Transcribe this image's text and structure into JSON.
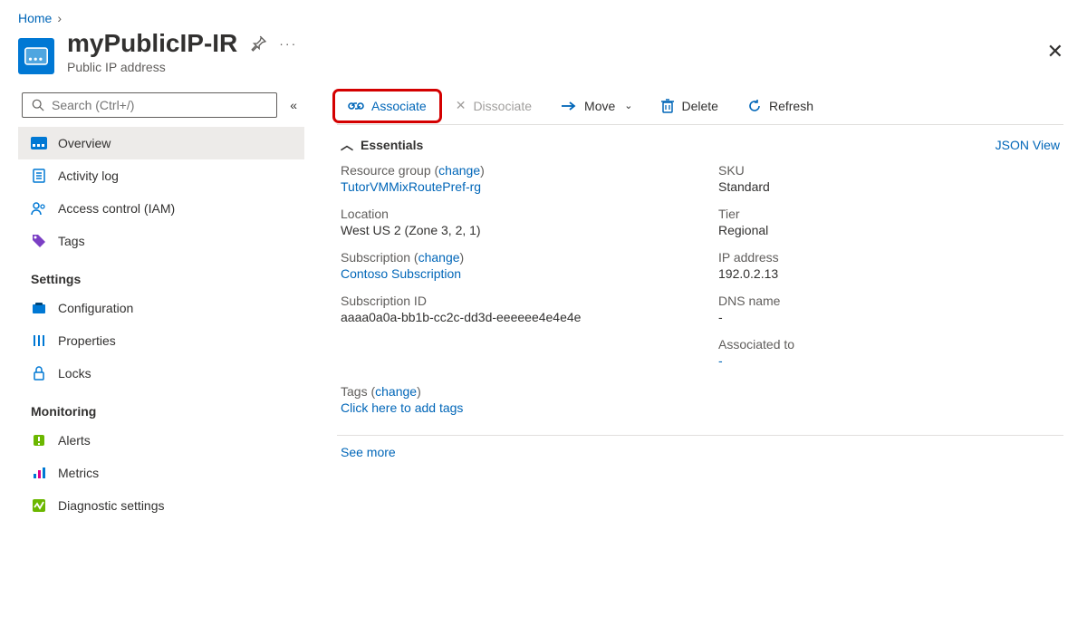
{
  "breadcrumb": {
    "home": "Home"
  },
  "header": {
    "title": "myPublicIP-IR",
    "subtitle": "Public IP address"
  },
  "search": {
    "placeholder": "Search (Ctrl+/)"
  },
  "sidebar": {
    "items": [
      {
        "label": "Overview"
      },
      {
        "label": "Activity log"
      },
      {
        "label": "Access control (IAM)"
      },
      {
        "label": "Tags"
      }
    ],
    "section_settings": "Settings",
    "settings_items": [
      {
        "label": "Configuration"
      },
      {
        "label": "Properties"
      },
      {
        "label": "Locks"
      }
    ],
    "section_monitoring": "Monitoring",
    "monitoring_items": [
      {
        "label": "Alerts"
      },
      {
        "label": "Metrics"
      },
      {
        "label": "Diagnostic settings"
      }
    ]
  },
  "toolbar": {
    "associate": "Associate",
    "dissociate": "Dissociate",
    "move": "Move",
    "delete": "Delete",
    "refresh": "Refresh"
  },
  "essentials": {
    "heading": "Essentials",
    "json_view": "JSON View",
    "left": {
      "resource_group_label": "Resource group (",
      "change": "change",
      "close_paren": ")",
      "resource_group_value": "TutorVMMixRoutePref-rg",
      "location_label": "Location",
      "location_value": "West US 2 (Zone 3, 2, 1)",
      "subscription_label": "Subscription (",
      "subscription_value": "Contoso Subscription",
      "subscription_id_label": "Subscription ID",
      "subscription_id_value": "aaaa0a0a-bb1b-cc2c-dd3d-eeeeee4e4e4e"
    },
    "right": {
      "sku_label": "SKU",
      "sku_value": "Standard",
      "tier_label": "Tier",
      "tier_value": "Regional",
      "ip_label": "IP address",
      "ip_value": "192.0.2.13",
      "dns_label": "DNS name",
      "dns_value": "-",
      "assoc_label": "Associated to",
      "assoc_value": "-"
    },
    "tags_label": "Tags (",
    "tags_link": "Click here to add tags",
    "see_more": "See more"
  }
}
